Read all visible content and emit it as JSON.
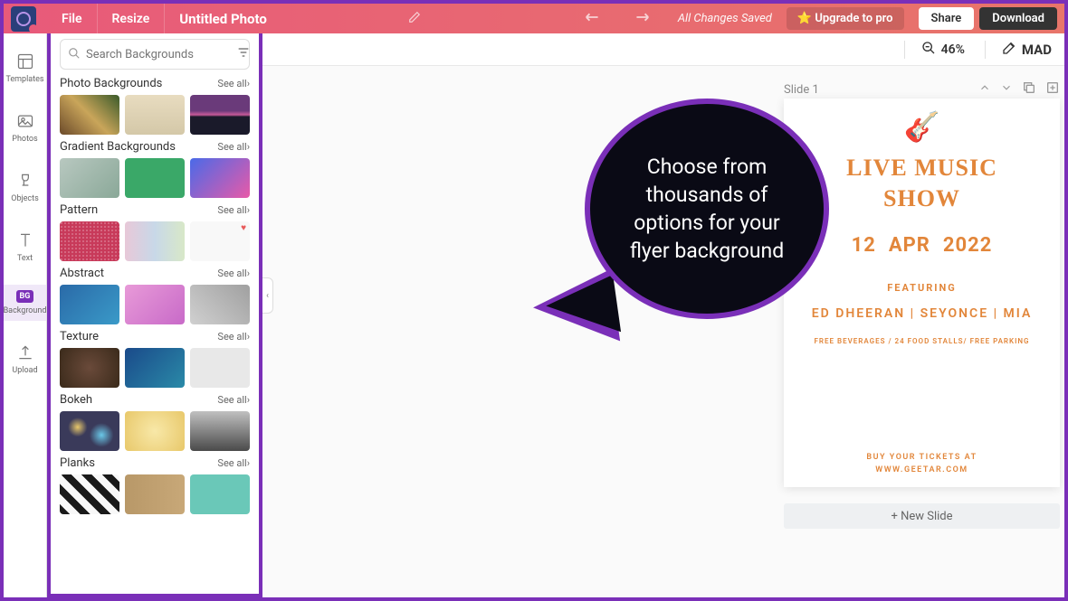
{
  "topbar": {
    "file": "File",
    "resize": "Resize",
    "doc_title": "Untitled Photo",
    "saved": "All Changes Saved",
    "upgrade": "⭐ Upgrade to pro",
    "share": "Share",
    "download": "Download"
  },
  "rail": {
    "templates": "Templates",
    "photos": "Photos",
    "objects": "Objects",
    "text": "Text",
    "background_badge": "BG",
    "background": "Background",
    "upload": "Upload"
  },
  "search": {
    "placeholder": "Search Backgrounds"
  },
  "categories": [
    {
      "title": "Photo Backgrounds",
      "see": "See all"
    },
    {
      "title": "Gradient Backgrounds",
      "see": "See all"
    },
    {
      "title": "Pattern",
      "see": "See all"
    },
    {
      "title": "Abstract",
      "see": "See all"
    },
    {
      "title": "Texture",
      "see": "See all"
    },
    {
      "title": "Bokeh",
      "see": "See all"
    },
    {
      "title": "Planks",
      "see": "See all"
    }
  ],
  "canvas": {
    "zoom": "46%",
    "brand": "MAD",
    "slide_label": "Slide 1",
    "new_slide": "+ New Slide"
  },
  "flyer": {
    "title1": "LIVE MUSIC",
    "title2": "SHOW",
    "day": "12",
    "month": "APR",
    "year": "2022",
    "featuring": "FEATURING",
    "artists": "ED DHEERAN | SEYONCE | MIA",
    "info": "FREE BEVERAGES / 24 FOOD STALLS/ FREE PARKING",
    "buy1": "BUY YOUR TICKETS AT",
    "buy2": "WWW.GEETAR.COM"
  },
  "callout": {
    "text": "Choose from thousands of options for your flyer background"
  }
}
